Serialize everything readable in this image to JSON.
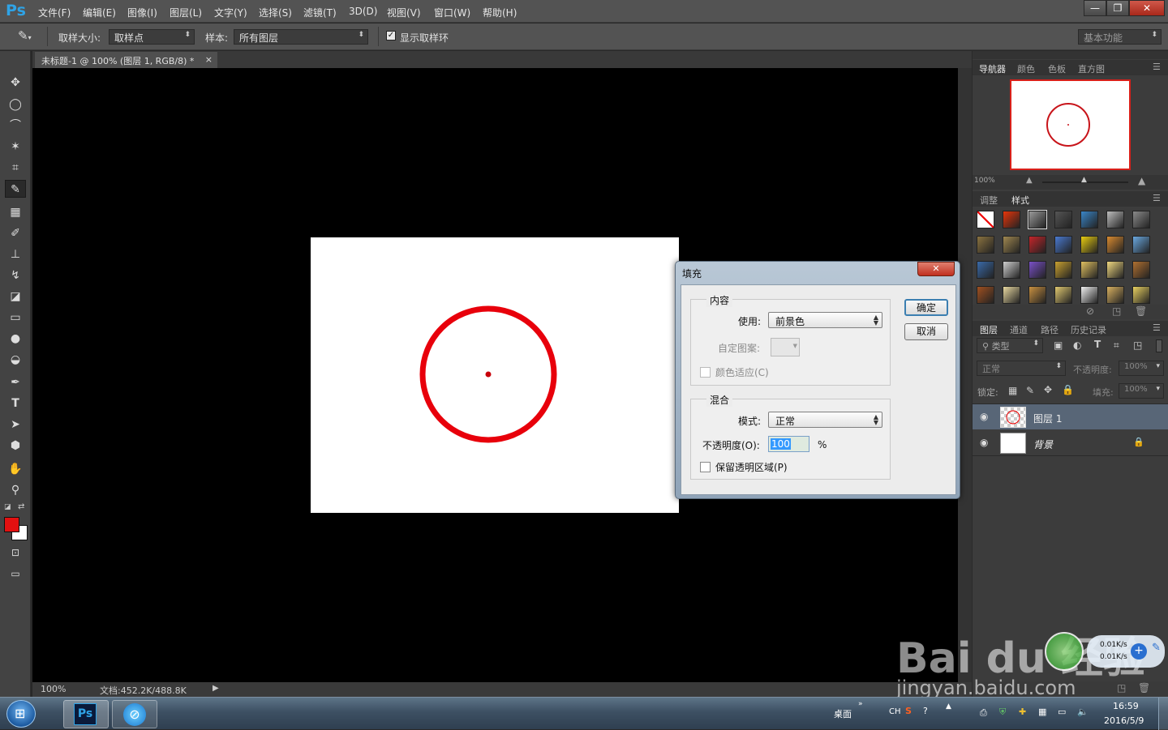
{
  "app": {
    "logo": "Ps"
  },
  "menu": [
    "文件(F)",
    "编辑(E)",
    "图像(I)",
    "图层(L)",
    "文字(Y)",
    "选择(S)",
    "滤镜(T)",
    "3D(D)",
    "视图(V)",
    "窗口(W)",
    "帮助(H)"
  ],
  "window_controls": {
    "minimize": "—",
    "restore": "❐",
    "close": "✕"
  },
  "options": {
    "sample_size_label": "取样大小:",
    "sample_size_value": "取样点",
    "sample_label": "样本:",
    "sample_value": "所有图层",
    "show_ring_label": "显示取样环",
    "show_ring_checked": true,
    "workspace": "基本功能"
  },
  "document": {
    "tab_title": "未标题-1 @ 100% (图层 1, RGB/8) *",
    "tab_close": "×",
    "zoom": "100%",
    "doc_info": "文档:452.2K/488.8K",
    "circle_color": "#e8000b",
    "canvas_bg": "#ffffff"
  },
  "colors": {
    "foreground": "#e31010",
    "background": "#ffffff",
    "accent": "#2fa3e6"
  },
  "navigator": {
    "tabs": [
      "导航器",
      "颜色",
      "色板",
      "直方图"
    ],
    "zoom": "100%"
  },
  "styles_panel": {
    "tabs": [
      "调整",
      "样式"
    ],
    "swatches": [
      "#ffffff",
      "#e8350a",
      "#9a9a9a",
      "#555555",
      "#3a86c8",
      "#bdbdbd",
      "#8a8a8a",
      "#8b7340",
      "#a08850",
      "#c4252a",
      "#4a7ad0",
      "#e8cc10",
      "#d88a30",
      "#6aa8e0",
      "#3a6aa8",
      "#cfcfcf",
      "#7a50c8",
      "#c8a030",
      "#e0c060",
      "#f0d880",
      "#b07030",
      "#a05020",
      "#e8d8a0",
      "#c89040",
      "#e0c870",
      "#f0f0f0",
      "#d8b060",
      "#e8d060"
    ]
  },
  "layers_panel": {
    "tabs": [
      "图层",
      "通道",
      "路径",
      "历史记录"
    ],
    "filter": "类型",
    "blend_mode": "正常",
    "opacity_label": "不透明度:",
    "opacity": "100%",
    "lock_label": "锁定:",
    "fill_label": "填充:",
    "fill": "100%",
    "layers": [
      {
        "name": "图层 1",
        "selected": true
      },
      {
        "name": "背景",
        "selected": false,
        "locked": true
      }
    ]
  },
  "dialog": {
    "title": "填充",
    "close": "✕",
    "content_group": "内容",
    "use_label": "使用:",
    "use_value": "前景色",
    "pattern_label": "自定图案:",
    "color_adapt_label": "颜色适应(C)",
    "blend_group": "混合",
    "mode_label": "模式:",
    "mode_value": "正常",
    "opacity_label": "不透明度(O):",
    "opacity_value": "100",
    "opacity_unit": "%",
    "preserve_label": "保留透明区域(P)",
    "ok": "确定",
    "cancel": "取消"
  },
  "taskbar": {
    "desktop_label": "桌面",
    "lang": "CH",
    "time": "16:59",
    "date": "2016/5/9",
    "net_up": "0.01K/s",
    "net_down": "0.01K/s",
    "ps_label": "Ps"
  },
  "watermark": {
    "brand": "Bai du 经验",
    "url": "jingyan.baidu.com"
  }
}
